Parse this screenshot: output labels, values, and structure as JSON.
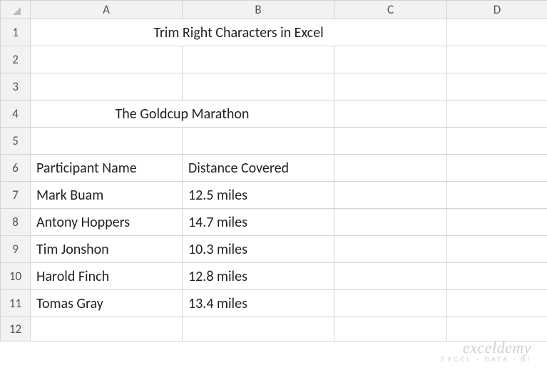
{
  "columns": [
    "A",
    "B",
    "C",
    "D"
  ],
  "row_numbers": [
    "1",
    "2",
    "3",
    "4",
    "5",
    "6",
    "7",
    "8",
    "9",
    "10",
    "11",
    "12"
  ],
  "banner": {
    "title": "Trim Right Characters in Excel"
  },
  "section": {
    "title": "The Goldcup Marathon"
  },
  "table": {
    "headers": {
      "col1": "Participant Name",
      "col2": "Distance Covered"
    },
    "rows": [
      {
        "name": "Mark Buam",
        "dist": "12.5 miles"
      },
      {
        "name": "Antony Hoppers",
        "dist": "14.7 miles"
      },
      {
        "name": "Tim Jonshon",
        "dist": "10.3 miles"
      },
      {
        "name": "Harold Finch",
        "dist": "12.8 miles"
      },
      {
        "name": "Tomas Gray",
        "dist": "13.4 miles"
      }
    ]
  },
  "watermark": {
    "line1": "exceldemy",
    "line2": "EXCEL · DATA · BI"
  }
}
